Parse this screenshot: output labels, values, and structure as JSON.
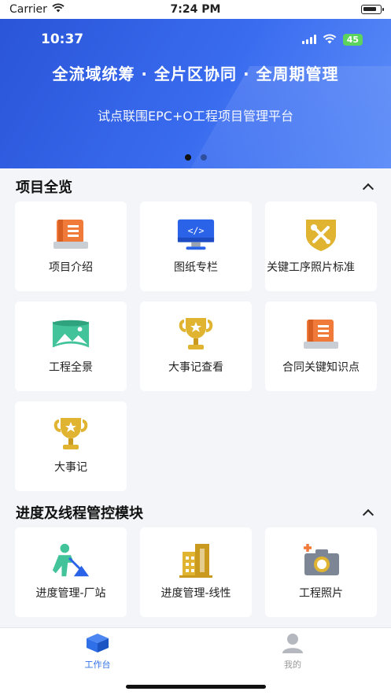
{
  "status_bar": {
    "carrier": "Carrier",
    "time": "7:24 PM"
  },
  "banner": {
    "inner_time": "10:37",
    "inner_battery": "45",
    "headline": "全流域统筹 · 全片区协同 · 全周期管理",
    "subline": "试点联围EPC+O工程项目管理平台",
    "page_count": 2,
    "active_page": 1
  },
  "sections": {
    "overview": {
      "title": "项目全览",
      "items": [
        {
          "label": "项目介绍",
          "icon": "notebook-icon"
        },
        {
          "label": "图纸专栏",
          "icon": "monitor-code-icon"
        },
        {
          "label": "关键工序照片标准",
          "icon": "tools-shield-icon"
        },
        {
          "label": "工程全景",
          "icon": "panorama-icon"
        },
        {
          "label": "大事记查看",
          "icon": "trophy-icon"
        },
        {
          "label": "合同关键知识点",
          "icon": "notebook-icon"
        },
        {
          "label": "大事记",
          "icon": "trophy-icon"
        }
      ]
    },
    "progress": {
      "title": "进度及线程管控模块",
      "items": [
        {
          "label": "进度管理-厂站",
          "icon": "worker-shovel-icon"
        },
        {
          "label": "进度管理-线性",
          "icon": "building-icon"
        },
        {
          "label": "工程照片",
          "icon": "camera-plus-icon"
        }
      ]
    }
  },
  "tabbar": {
    "work": {
      "label": "工作台",
      "icon": "cube-icon"
    },
    "mine": {
      "label": "我的",
      "icon": "user-icon"
    }
  },
  "colors": {
    "accent": "#2f6fe8",
    "icon_orange": "#f07a3a",
    "icon_gold": "#e0b431",
    "icon_green": "#43c39a",
    "icon_blue": "#2a62e8"
  }
}
